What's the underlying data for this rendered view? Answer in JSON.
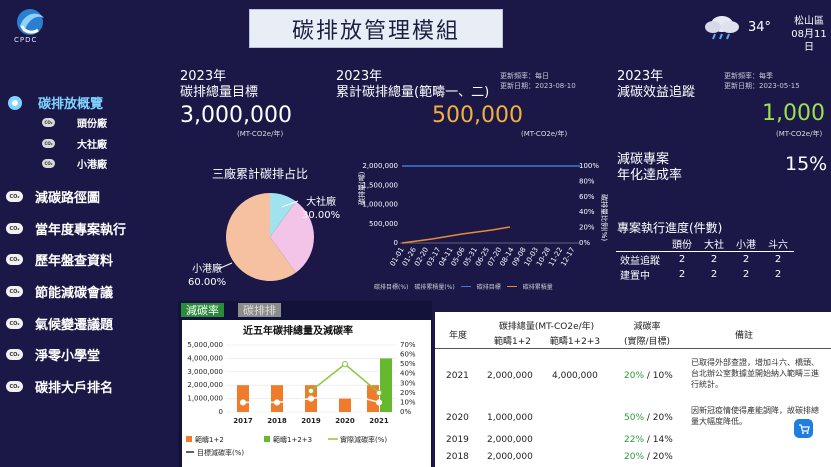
{
  "app": {
    "logo_text": "CPDC",
    "title": "碳排放管理模組"
  },
  "weather": {
    "temperature": "34°",
    "location": "松山區",
    "date": "08月11日"
  },
  "sidebar": {
    "items": [
      {
        "label": "碳排放概覽"
      },
      {
        "label": "減碳路徑圖"
      },
      {
        "label": "當年度專案執行"
      },
      {
        "label": "歷年盤查資料"
      },
      {
        "label": "節能減碳會議"
      },
      {
        "label": "氣候變遷議題"
      },
      {
        "label": "淨零小學堂"
      },
      {
        "label": "碳排大戶排名"
      }
    ],
    "sub_items": [
      {
        "label": "頭份廠"
      },
      {
        "label": "大社廠"
      },
      {
        "label": "小港廠"
      }
    ],
    "icon_text": "CO₂"
  },
  "kpi": {
    "target": {
      "year": "2023年",
      "label": "碳排總量目標",
      "value": "3,000,000",
      "unit": "(MT-CO2e/年)"
    },
    "cumulative": {
      "year": "2023年",
      "label": "累計碳排總量(範疇一、二)",
      "value": "500,000",
      "unit": "(MT-CO2e/年)",
      "update_freq": "更新頻率：每日",
      "update_date": "更新日期：2023-08-10"
    },
    "reduction": {
      "year": "2023年",
      "label": "減碳效益追蹤",
      "value": "1,000",
      "unit": "(MT-CO2e/年)",
      "update_freq": "更新頻率：每季",
      "update_date": "更新日期：2023-05-15"
    },
    "rate": {
      "label1": "減碳專案",
      "label2": "年化達成率",
      "value": "15%"
    }
  },
  "pie_chart": {
    "title": "三廠累計碳排占比",
    "slices": [
      {
        "name": "小港廠",
        "percent": 60.0,
        "label": "60.00%",
        "color": "#f6c1a0"
      },
      {
        "name": "大社廠",
        "percent": 30.0,
        "label": "30.00%",
        "color": "#f4c3e8"
      },
      {
        "name": "頭份廠",
        "percent": 10.0,
        "label": "",
        "color": "#9fe3ee"
      }
    ]
  },
  "line_chart": {
    "x_labels": [
      "01-01",
      "01-26",
      "02-20",
      "03-17",
      "04-11",
      "05-06",
      "05-31",
      "06-25",
      "07-20",
      "08-14",
      "09-08",
      "10-03",
      "10-28",
      "11-22",
      "12-17"
    ],
    "y_left_labels": [
      "2,000,000",
      "1,500,000",
      "1,000,000",
      "500,000",
      "0"
    ],
    "y_right_labels": [
      "100%",
      "80%",
      "60%",
      "40%",
      "20%",
      "0%"
    ],
    "y_left_title": "碳排量(噸)",
    "y_right_title": "碳排量比例(%)",
    "legend": [
      "碳排目標(%)",
      "碳排累積量(%)",
      "碳排目標",
      "碳排累積量"
    ]
  },
  "progress": {
    "title": "專案執行進度(件數)",
    "columns": [
      "",
      "頭份",
      "大社",
      "小港",
      "斗六"
    ],
    "rows": [
      {
        "label": "效益追蹤",
        "values": [
          "2",
          "2",
          "2",
          "2"
        ]
      },
      {
        "label": "建置中",
        "values": [
          "2",
          "2",
          "2",
          "2"
        ]
      }
    ]
  },
  "tabs": {
    "active": "減碳率",
    "inactive": "碳排排"
  },
  "chart_data": {
    "type": "bar",
    "title": "近五年碳排總量及減碳率",
    "categories": [
      "2017",
      "2018",
      "2019",
      "2020",
      "2021"
    ],
    "ylim": [
      0,
      5000000
    ],
    "y2lim": [
      0,
      70
    ],
    "y_left_labels": [
      "5,000,000",
      "4,000,000",
      "3,000,000",
      "2,000,000",
      "1,000,000",
      "0"
    ],
    "y_right_labels": [
      "70%",
      "60%",
      "50%",
      "40%",
      "30%",
      "20%",
      "10%",
      "0%"
    ],
    "series": [
      {
        "name": "範疇1+2",
        "type": "bar",
        "color": "#f07b2a",
        "values": [
          2000000,
          2000000,
          2000000,
          1000000,
          2000000
        ]
      },
      {
        "name": "範疇1+2+3",
        "type": "bar",
        "color": "#66b82e",
        "values": [
          null,
          null,
          null,
          null,
          4000000
        ]
      },
      {
        "name": "實際減碳率(%)",
        "type": "line",
        "color": "#8cc63f",
        "values": [
          null,
          null,
          22,
          50,
          20
        ]
      },
      {
        "name": "目標減碳率(%)",
        "type": "line",
        "color": "#ffffff",
        "values": [
          10,
          10,
          14,
          20,
          10
        ]
      }
    ]
  },
  "table": {
    "headers": {
      "year": "年度",
      "total": "碳排總量(MT-CO2e/年)",
      "scope12": "範疇1+2",
      "scope123": "範疇1+2+3",
      "rate": "減碳率",
      "rate_sub": "(實際/目標)",
      "note": "備註"
    },
    "rows": [
      {
        "year": "2021",
        "scope12": "2,000,000",
        "scope123": "4,000,000",
        "rate_actual": "20%",
        "rate_target": "/ 10%",
        "note": "已取得外部查證，增加斗六、橋頭、台北辦公室數據並開始納入範疇三進行統計。"
      },
      {
        "year": "2020",
        "scope12": "1,000,000",
        "scope123": "",
        "rate_actual": "50%",
        "rate_target": "/ 20%",
        "note": "因新冠疫情使得產能調降，故碳排總量大幅度降低。"
      },
      {
        "year": "2019",
        "scope12": "2,000,000",
        "scope123": "",
        "rate_actual": "22%",
        "rate_target": "/ 14%",
        "note": ""
      },
      {
        "year": "2018",
        "scope12": "2,000,000",
        "scope123": "",
        "rate_actual": "20%",
        "rate_target": "/ 20%",
        "note": ""
      }
    ]
  }
}
